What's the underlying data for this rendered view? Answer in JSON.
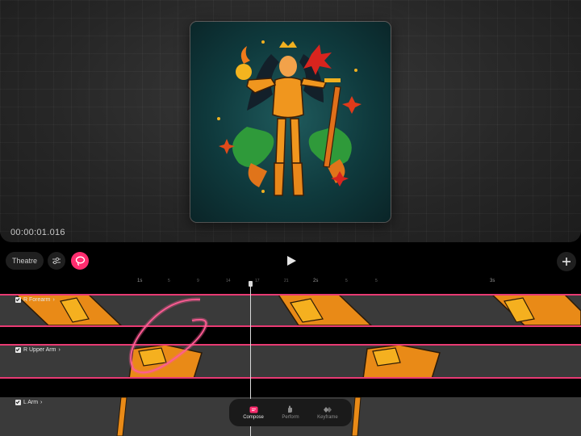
{
  "stage": {
    "timecode": "00:00:01.016",
    "artwork_icon": "illustration-of-armored-warrior-woman"
  },
  "toolbar": {
    "theatre_label": "Theatre",
    "tool_icon": "sliders-icon",
    "lasso_icon": "lasso-icon",
    "play_icon": "play-icon",
    "add_icon": "plus-icon",
    "accent_color": "#ff2d6f"
  },
  "ruler": {
    "major": [
      "1s",
      "2s",
      "3s"
    ],
    "minor": [
      "5",
      "9",
      "14",
      "17",
      "21",
      "5",
      "5"
    ]
  },
  "tracks": [
    {
      "label": "R Forearm",
      "checked": true
    },
    {
      "label": "R Upper Arm",
      "checked": true
    },
    {
      "label": "L Arm",
      "checked": true
    }
  ],
  "modes": [
    {
      "label": "Compose",
      "icon": "compose-icon",
      "active": true
    },
    {
      "label": "Perform",
      "icon": "hand-icon",
      "active": false
    },
    {
      "label": "Keyframe",
      "icon": "keyframe-icon",
      "active": false
    }
  ]
}
